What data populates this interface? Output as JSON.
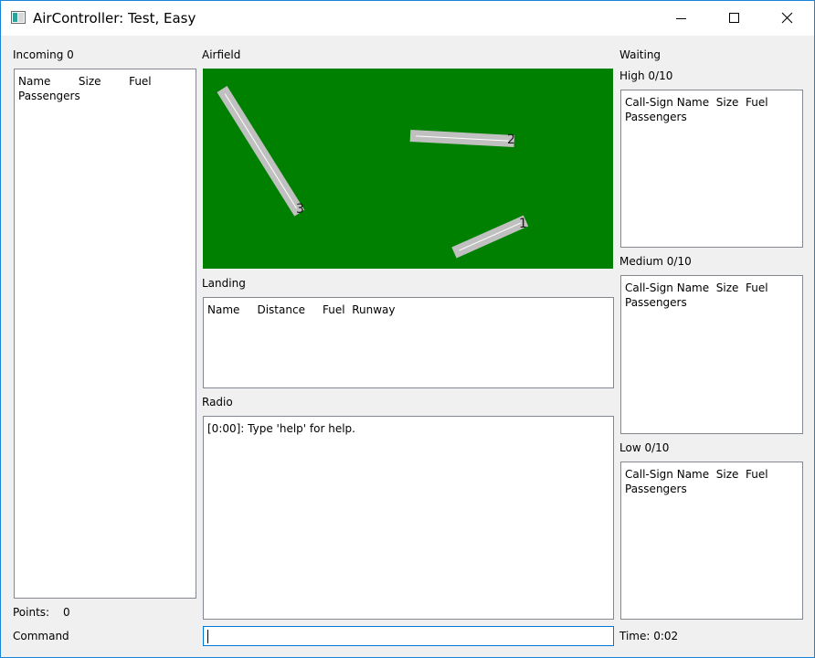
{
  "window": {
    "title": "AirController: Test, Easy"
  },
  "incoming": {
    "label": "Incoming 0",
    "header_line1": "Name        Size        Fuel",
    "header_line2": "Passengers"
  },
  "points": {
    "label": "Points:",
    "value": "0"
  },
  "command": {
    "label": "Command",
    "value": ""
  },
  "airfield": {
    "label": "Airfield",
    "background_color": "#008000",
    "runway_color": "#c0c0c0",
    "runways": [
      {
        "number": "1"
      },
      {
        "number": "2"
      },
      {
        "number": "3"
      }
    ]
  },
  "landing": {
    "label": "Landing",
    "header": "Name     Distance     Fuel  Runway"
  },
  "radio": {
    "label": "Radio",
    "messages": [
      "[0:00]: Type 'help' for help."
    ]
  },
  "waiting": {
    "label": "Waiting",
    "high": {
      "label": "High 0/10",
      "header_line1": "Call-Sign Name  Size  Fuel",
      "header_line2": "Passengers"
    },
    "medium": {
      "label": "Medium 0/10",
      "header_line1": "Call-Sign Name  Size  Fuel",
      "header_line2": "Passengers"
    },
    "low": {
      "label": "Low 0/10",
      "header_line1": "Call-Sign Name  Size  Fuel",
      "header_line2": "Passengers"
    }
  },
  "time": {
    "label": "Time: 0:02"
  }
}
